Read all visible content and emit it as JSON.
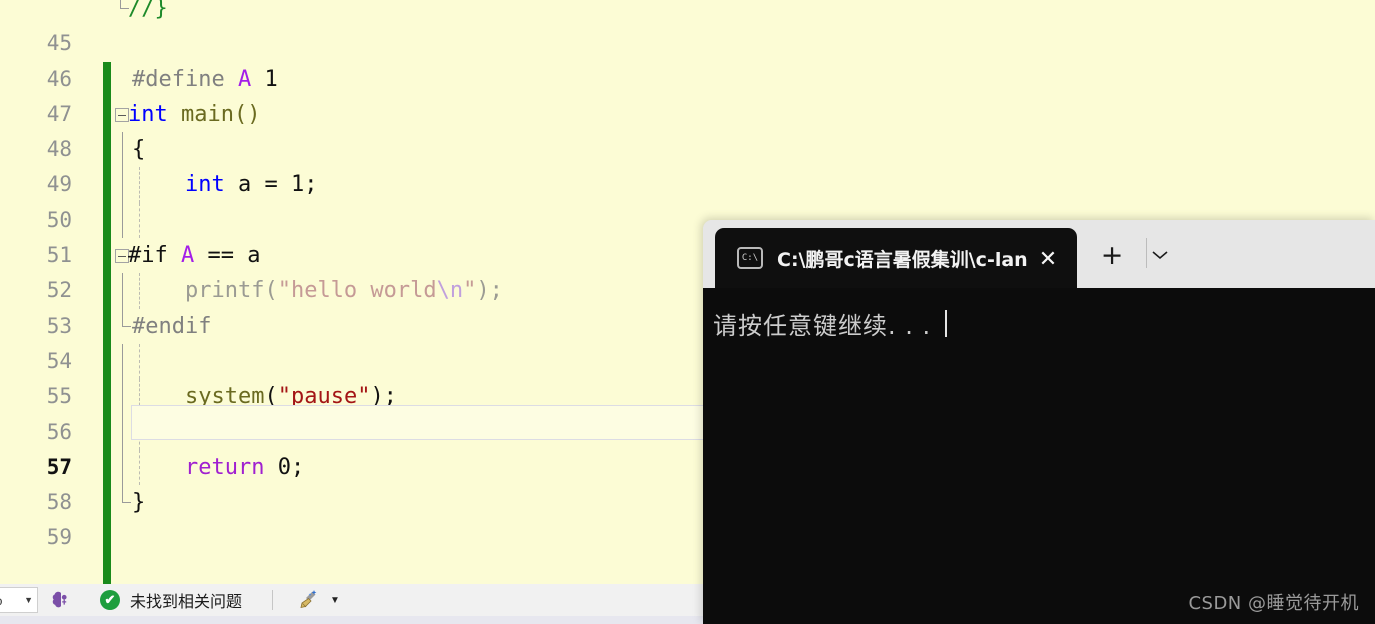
{
  "editor": {
    "background_color": "#fcfcd5",
    "change_bar_color": "#1a8a1a",
    "current_line": 57,
    "lines": [
      {
        "num": "45",
        "segments": [
          {
            "t": "//}",
            "c": "comment"
          }
        ]
      },
      {
        "num": "46",
        "segments": []
      },
      {
        "num": "47",
        "segments": [
          {
            "t": "#define ",
            "c": "pre-gray"
          },
          {
            "t": "A",
            "c": "macro"
          },
          {
            "t": " 1",
            "c": "plain"
          }
        ]
      },
      {
        "num": "48",
        "segments": [
          {
            "t": "int",
            "c": "kw-blue"
          },
          {
            "t": " main()",
            "c": "fn"
          }
        ]
      },
      {
        "num": "49",
        "segments": [
          {
            "t": "{",
            "c": "plain"
          }
        ]
      },
      {
        "num": "50",
        "segments": [
          {
            "t": "    ",
            "c": "plain"
          },
          {
            "t": "int",
            "c": "kw-blue"
          },
          {
            "t": " a = ",
            "c": "plain"
          },
          {
            "t": "1;",
            "c": "plain"
          }
        ]
      },
      {
        "num": "51",
        "segments": []
      },
      {
        "num": "52",
        "segments": [
          {
            "t": "#if ",
            "c": "plain"
          },
          {
            "t": "A",
            "c": "macro"
          },
          {
            "t": " == a",
            "c": "plain"
          }
        ]
      },
      {
        "num": "53",
        "segments": [
          {
            "t": "    printf(",
            "c": "inactive"
          },
          {
            "t": "\"hello world",
            "c": "inactive-str"
          },
          {
            "t": "\\n",
            "c": "inactive-esc"
          },
          {
            "t": "\"",
            "c": "inactive-str"
          },
          {
            "t": ");",
            "c": "inactive"
          }
        ]
      },
      {
        "num": "54",
        "segments": [
          {
            "t": "#endif",
            "c": "pre-gray"
          }
        ]
      },
      {
        "num": "55",
        "segments": []
      },
      {
        "num": "56",
        "segments": [
          {
            "t": "    ",
            "c": "plain"
          },
          {
            "t": "system",
            "c": "fn"
          },
          {
            "t": "(",
            "c": "plain"
          },
          {
            "t": "\"pause\"",
            "c": "str"
          },
          {
            "t": ");",
            "c": "plain"
          }
        ]
      },
      {
        "num": "57",
        "segments": []
      },
      {
        "num": "58",
        "segments": [
          {
            "t": "    ",
            "c": "plain"
          },
          {
            "t": "return",
            "c": "kw-purple"
          },
          {
            "t": " 0;",
            "c": "plain"
          }
        ]
      },
      {
        "num": "59",
        "segments": [
          {
            "t": "}",
            "c": "plain"
          }
        ]
      }
    ]
  },
  "status_bar": {
    "zoom_value": "%",
    "zoom_caret_icon": "chevron-down-icon",
    "brain_icon": "brain-icon",
    "check_icon": "check-icon",
    "check_mark": "✔",
    "issues_text": "未找到相关问题",
    "broom_icon": "broom-icon",
    "broom_caret": "▼"
  },
  "terminal": {
    "tab": {
      "icon_name": "console-icon",
      "icon_label": "C:\\",
      "title": "C:\\鹏哥c语言暑假集训\\c-langu",
      "close_label": "✕"
    },
    "new_tab_label": "+",
    "dropdown_label": "⌄",
    "output_line": "请按任意键继续. . .",
    "background_color": "#0c0c0c",
    "titlebar_color": "#e6e6e6"
  },
  "watermark": {
    "text": "CSDN @睡觉待开机"
  }
}
